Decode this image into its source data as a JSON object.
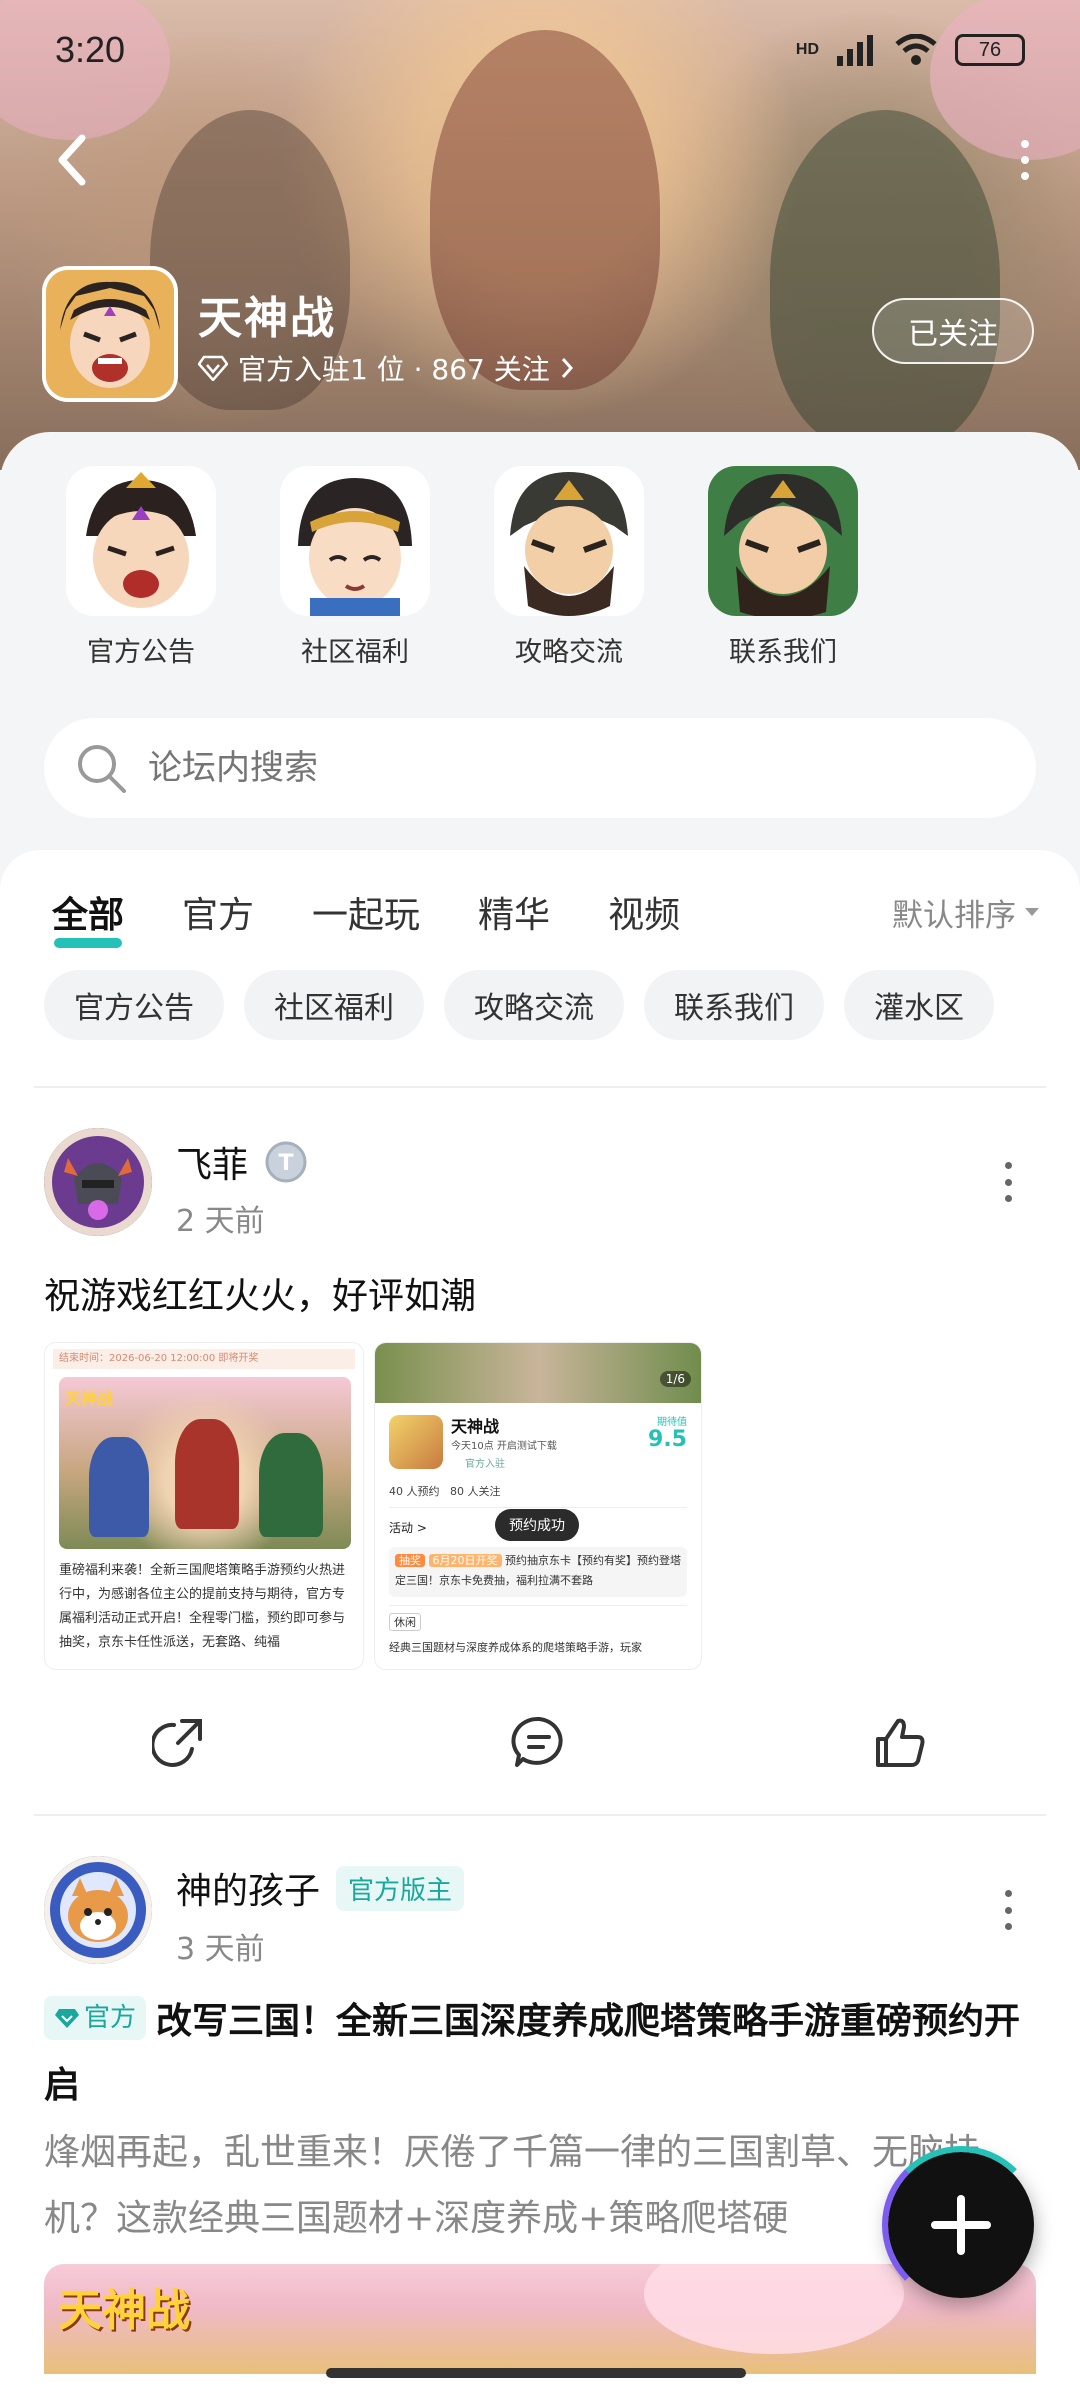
{
  "status_bar": {
    "time": "3:20",
    "network": "HD",
    "battery": "76"
  },
  "header": {
    "forum_name": "天神战",
    "meta": "官方入驻1 位 · 867 关注",
    "follow_label": "已关注"
  },
  "quick_links": [
    {
      "label": "官方公告"
    },
    {
      "label": "社区福利"
    },
    {
      "label": "攻略交流"
    },
    {
      "label": "联系我们"
    }
  ],
  "search": {
    "placeholder": "论坛内搜索"
  },
  "tabs": [
    {
      "label": "全部",
      "active": true
    },
    {
      "label": "官方"
    },
    {
      "label": "一起玩"
    },
    {
      "label": "精华"
    },
    {
      "label": "视频"
    }
  ],
  "sort": {
    "label": "默认排序"
  },
  "chips": [
    "官方公告",
    "社区福利",
    "攻略交流",
    "联系我们",
    "灌水区"
  ],
  "posts": [
    {
      "user": "飞菲",
      "time": "2 天前",
      "text": "祝游戏红红火火，好评如潮",
      "images": [
        {
          "top_note": "结束时间：2026-06-20 12:00:00 即将开奖",
          "logo": "天神战",
          "body": "重磅福利来袭！全新三国爬塔策略手游预约火热进行中，为感谢各位主公的提前支持与期待，官方专属福利活动正式开启！全程零门槛，预约即可参与抽奖，京东卡任性派送，无套路、纯福"
        },
        {
          "page": "1/6",
          "title": "天神战",
          "subtitle": "今天10点 开启测试下载",
          "official": "官方入驻",
          "score_label": "期待值",
          "score": "9.5",
          "stats": "40 人预约   80 人关注",
          "activity_label": "活动 >",
          "toast": "预约成功",
          "lottery_tag": "抽奖",
          "lottery_date": "6月20日开奖",
          "lottery_text": "预约抽京东卡【预约有奖】预约登塔定三国！京东卡免费抽，福利拉满不套路",
          "tag": "休闲",
          "desc": "经典三国题材与深度养成体系的爬塔策略手游，玩家"
        }
      ]
    },
    {
      "user": "神的孩子",
      "role": "官方版主",
      "time": "3 天前",
      "official_tag": "官方",
      "title": "改写三国！全新三国深度养成爬塔策略手游重磅预约开启",
      "excerpt": "烽烟再起，乱世重来！厌倦了千篇一律的三国割草、无脑挂机？这款经典三国题材+深度养成+策略爬塔硬",
      "banner_logo": "天神战"
    }
  ],
  "colors": {
    "accent": "#23c1b7",
    "brand_dark": "#111111"
  }
}
